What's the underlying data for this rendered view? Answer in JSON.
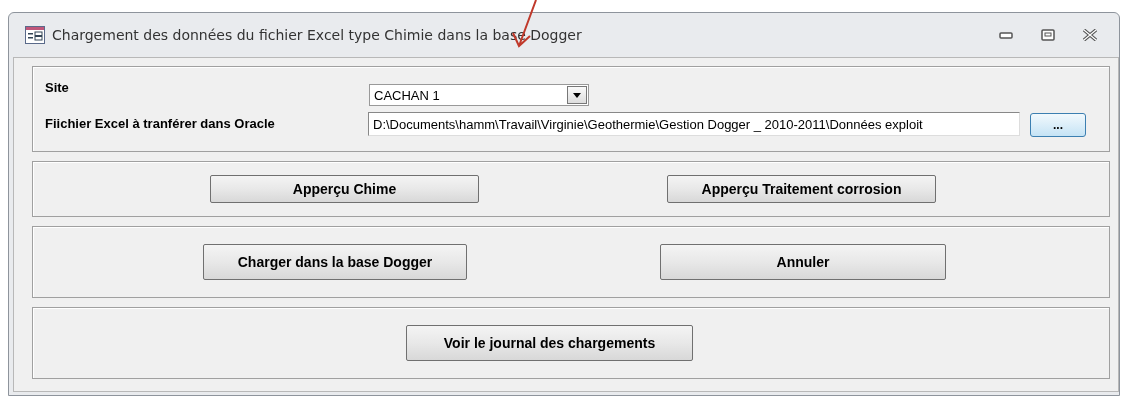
{
  "window": {
    "title": "Chargement des données du fichier Excel type Chimie dans la base Dogger"
  },
  "site": {
    "label": "Site",
    "value": "CACHAN 1"
  },
  "file": {
    "label": "Fiichier Excel à tranférer dans Oracle",
    "value": "D:\\Documents\\hamm\\Travail\\Virginie\\Geothermie\\Gestion Dogger _ 2010-2011\\Données exploit",
    "browse": "..."
  },
  "sections": [
    {
      "kind": "pair",
      "buttons": [
        "Apperçu Chime",
        "Apperçu Traitement corrosion"
      ]
    },
    {
      "kind": "pair-tall",
      "buttons": [
        "Charger dans la base Dogger",
        "Annuler"
      ]
    },
    {
      "kind": "single",
      "buttons": [
        "Voir le journal des chargements"
      ]
    }
  ]
}
